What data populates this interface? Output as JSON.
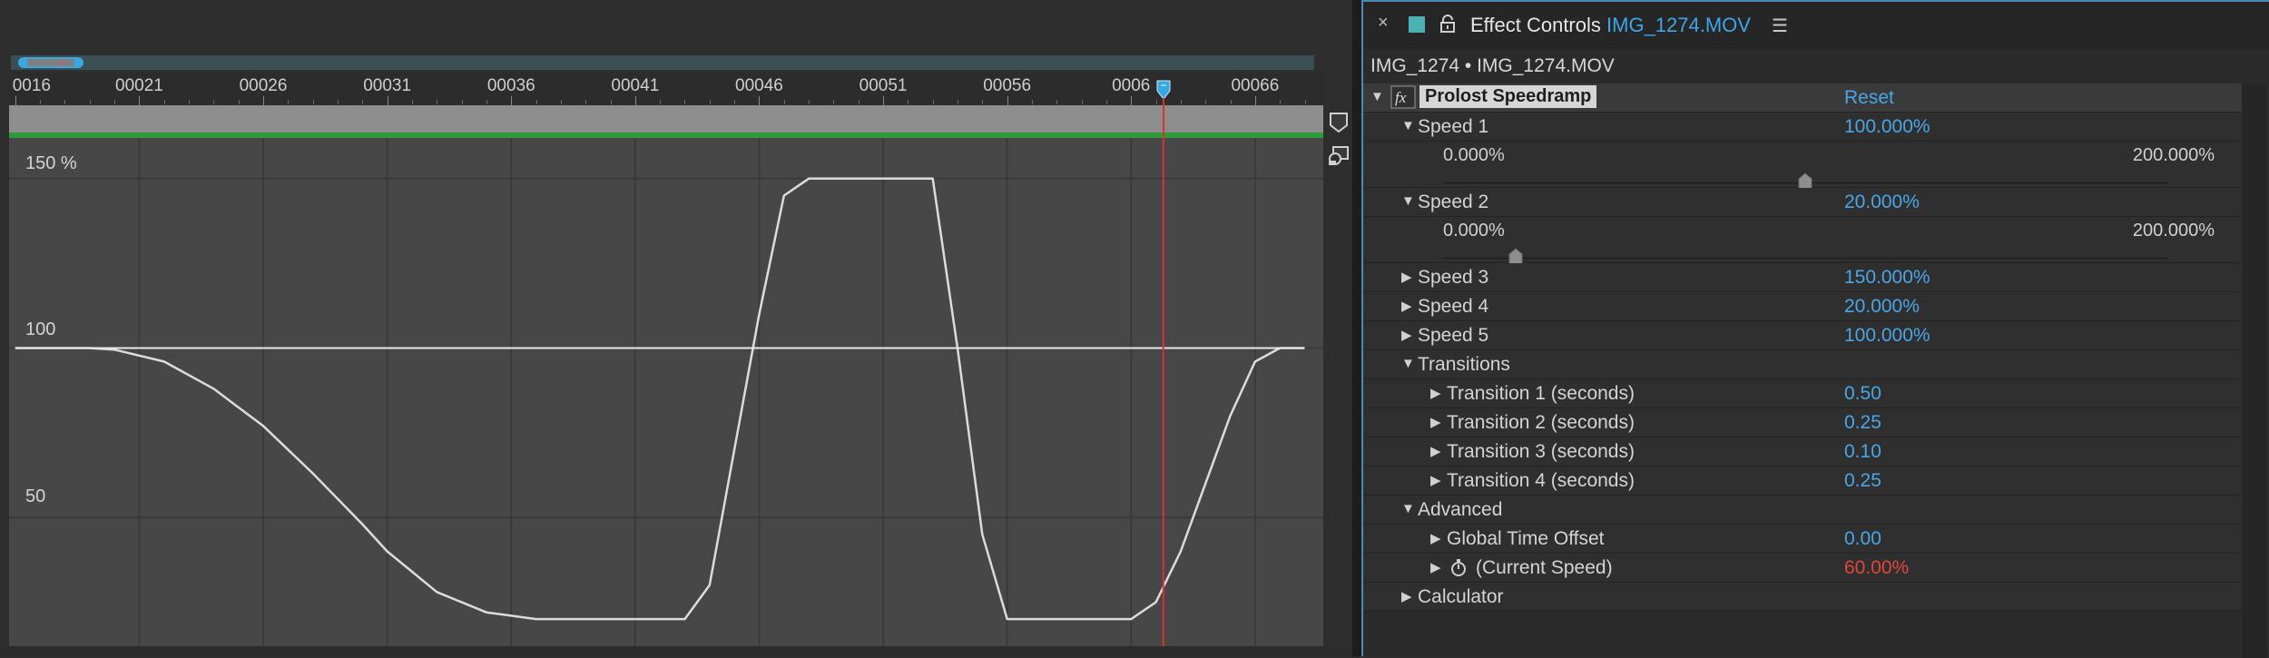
{
  "timeline": {
    "ticks": [
      "0016",
      "00021",
      "00026",
      "00031",
      "00036",
      "00041",
      "00046",
      "00051",
      "00056",
      "0006",
      "00066"
    ],
    "y_labels": [
      "150 %",
      "100",
      "50"
    ],
    "playhead_color": "#d9322b"
  },
  "chart_data": {
    "type": "line",
    "title": "",
    "xlabel": "",
    "ylabel": "",
    "x": [
      16,
      19,
      20,
      22,
      24,
      26,
      28,
      30,
      31,
      32,
      33,
      35,
      36,
      37,
      38,
      39,
      40,
      41,
      42,
      43,
      44,
      45,
      46,
      47,
      48,
      49,
      50,
      51,
      52,
      53,
      54,
      55,
      56,
      57,
      58,
      59,
      60,
      61,
      62,
      63,
      64,
      65,
      66,
      67,
      68
    ],
    "xlim": [
      15.75,
      68.75
    ],
    "ylim": [
      12,
      162
    ],
    "series": [
      {
        "values": [
          100,
          100,
          99.5,
          96,
          88,
          77,
          63,
          48,
          40,
          34,
          28,
          22,
          21,
          20,
          20,
          20,
          20,
          20,
          20,
          20,
          30,
          70,
          110,
          145,
          150,
          150,
          150,
          150,
          150,
          150,
          100,
          45,
          20,
          20,
          20,
          20,
          20,
          20,
          25,
          40,
          60,
          80,
          96,
          100,
          100
        ]
      },
      {
        "values": [
          100,
          100,
          100,
          100,
          100,
          100,
          100,
          100,
          100,
          100,
          100,
          100,
          100,
          100,
          100,
          100,
          100,
          100,
          100,
          100,
          100,
          100,
          100,
          100,
          100,
          100,
          100,
          100,
          100,
          100,
          100,
          100,
          100,
          100,
          100,
          100,
          100,
          100,
          100,
          100,
          100,
          100,
          100,
          100,
          100
        ]
      }
    ],
    "playhead_x": 62.3,
    "grid": true
  },
  "tab": {
    "close_glyph": "×",
    "title_prefix": "Effect Controls",
    "title_layer": "IMG_1274.MOV",
    "menu_glyph": "☰",
    "swatch_color": "#4cb1b3"
  },
  "layer_label": "IMG_1274 • IMG_1274.MOV",
  "effect": {
    "name": "Prolost Speedramp",
    "fx_glyph": "fx",
    "reset_label": "Reset"
  },
  "props": [
    {
      "label": "Speed 1",
      "value": "100.000%",
      "expanded": true,
      "slider": {
        "min": "0.000%",
        "max": "200.000%",
        "fraction": 0.5
      }
    },
    {
      "label": "Speed 2",
      "value": "20.000%",
      "expanded": true,
      "slider": {
        "min": "0.000%",
        "max": "200.000%",
        "fraction": 0.1
      }
    },
    {
      "label": "Speed 3",
      "value": "150.000%"
    },
    {
      "label": "Speed 4",
      "value": "20.000%"
    },
    {
      "label": "Speed 5",
      "value": "100.000%"
    },
    {
      "label": "Transitions",
      "expanded": true
    },
    {
      "label": "Transition 1 (seconds)",
      "value": "0.50"
    },
    {
      "label": "Transition 2 (seconds)",
      "value": "0.25"
    },
    {
      "label": "Transition 3 (seconds)",
      "value": "0.10"
    },
    {
      "label": "Transition 4 (seconds)",
      "value": "0.25"
    },
    {
      "label": "Advanced",
      "expanded": true
    },
    {
      "label": "Global Time Offset",
      "value": "0.00"
    },
    {
      "label": "(Current Speed)",
      "value": "60.00%",
      "value_color": "#e0463b",
      "icon": "stopwatch-icon"
    },
    {
      "label": "Calculator"
    }
  ]
}
